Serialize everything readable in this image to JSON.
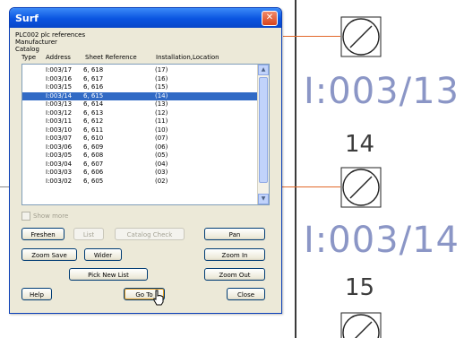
{
  "dialog": {
    "title": "Surf",
    "close_glyph": "✕",
    "info_lines": [
      "PLC002 plc references",
      "Manufacturer",
      "Catalog"
    ],
    "columns": [
      "Type",
      "Address",
      "Sheet Reference",
      "Installation,Location"
    ],
    "rows": [
      {
        "address": "I:003/17",
        "sheet": "6, 618",
        "loc": "(17)"
      },
      {
        "address": "I:003/16",
        "sheet": "6, 617",
        "loc": "(16)"
      },
      {
        "address": "I:003/15",
        "sheet": "6, 616",
        "loc": "(15)"
      },
      {
        "address": "I:003/14",
        "sheet": "6, 615",
        "loc": "(14)"
      },
      {
        "address": "I:003/13",
        "sheet": "6, 614",
        "loc": "(13)"
      },
      {
        "address": "I:003/12",
        "sheet": "6, 613",
        "loc": "(12)"
      },
      {
        "address": "I:003/11",
        "sheet": "6, 612",
        "loc": "(11)"
      },
      {
        "address": "I:003/10",
        "sheet": "6, 611",
        "loc": "(10)"
      },
      {
        "address": "I:003/07",
        "sheet": "6, 610",
        "loc": "(07)"
      },
      {
        "address": "I:003/06",
        "sheet": "6, 609",
        "loc": "(06)"
      },
      {
        "address": "I:003/05",
        "sheet": "6, 608",
        "loc": "(05)"
      },
      {
        "address": "I:003/04",
        "sheet": "6, 607",
        "loc": "(04)"
      },
      {
        "address": "I:003/03",
        "sheet": "6, 606",
        "loc": "(03)"
      },
      {
        "address": "I:003/02",
        "sheet": "6, 605",
        "loc": "(02)"
      }
    ],
    "selected_index": 3,
    "show_more_label": "Show more",
    "buttons": {
      "freshen": "Freshen",
      "list": "List",
      "catalog_check": "Catalog Check",
      "pan": "Pan",
      "zoom_save": "Zoom Save",
      "wider": "Wider",
      "zoom_in": "Zoom In",
      "pick_new_list": "Pick New List",
      "zoom_out": "Zoom Out",
      "help": "Help",
      "go_to": "Go To",
      "close": "Close"
    }
  },
  "canvas": {
    "address_1": "I:003/13",
    "number_1": "14",
    "address_2": "I:003/14",
    "number_2": "15",
    "text_color": "#8b96c6",
    "wire_color": "#e2682a"
  }
}
